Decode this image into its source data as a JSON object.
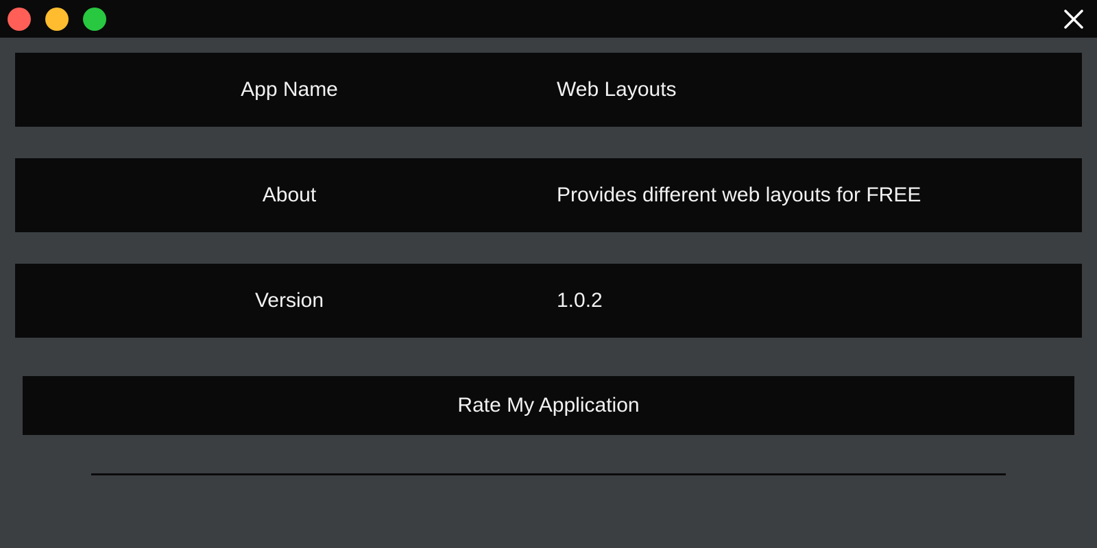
{
  "window": {
    "controls": {
      "close_color": "#ff5f57",
      "minimize_color": "#febc2e",
      "maximize_color": "#28c840",
      "dismiss_icon": "close-icon"
    }
  },
  "info_rows": [
    {
      "label": "App Name",
      "value": "Web Layouts"
    },
    {
      "label": "About",
      "value": "Provides different web layouts for FREE"
    },
    {
      "label": "Version",
      "value": "1.0.2"
    }
  ],
  "rate_button": {
    "label": "Rate My Application"
  },
  "colors": {
    "background": "#3b3f42",
    "panel": "#0a0a0a",
    "text": "#f2f2f2"
  }
}
